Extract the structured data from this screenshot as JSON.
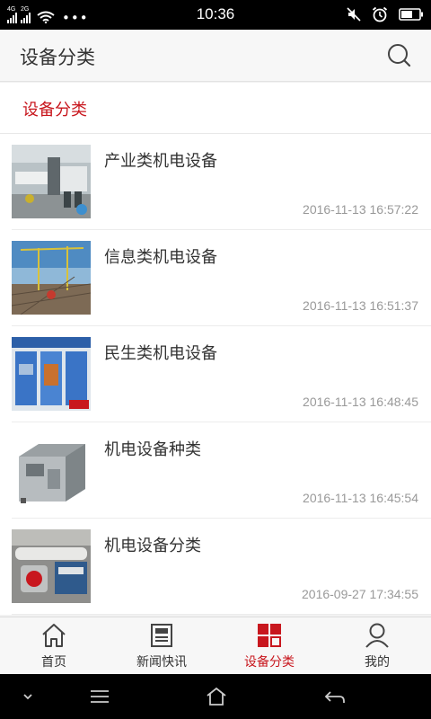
{
  "status_bar": {
    "time": "10:36",
    "net1": "4G",
    "net2": "2G"
  },
  "app_bar": {
    "title": "设备分类"
  },
  "section": {
    "header": "设备分类"
  },
  "items": [
    {
      "title": "产业类机电设备",
      "date": "2016-11-13 16:57:22"
    },
    {
      "title": "信息类机电设备",
      "date": "2016-11-13 16:51:37"
    },
    {
      "title": "民生类机电设备",
      "date": "2016-11-13 16:48:45"
    },
    {
      "title": "机电设备种类",
      "date": "2016-11-13 16:45:54"
    },
    {
      "title": "机电设备分类",
      "date": "2016-09-27 17:34:55"
    }
  ],
  "tabs": [
    {
      "label": "首页",
      "icon": "home-icon"
    },
    {
      "label": "新闻快讯",
      "icon": "newspaper-icon"
    },
    {
      "label": "设备分类",
      "icon": "grid-icon",
      "active": true
    },
    {
      "label": "我的",
      "icon": "user-icon"
    }
  ],
  "colors": {
    "accent": "#c8171e",
    "text": "#333333",
    "muted": "#999999"
  }
}
